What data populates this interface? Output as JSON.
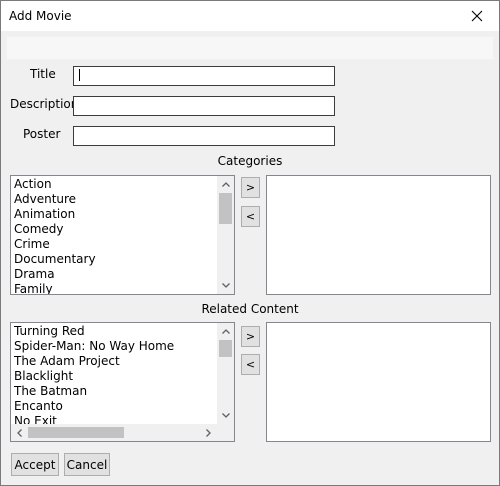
{
  "window": {
    "title": "Add Movie"
  },
  "form": {
    "title_label": "Title",
    "description_label": "Description",
    "poster_label": "Poster",
    "title_value": "",
    "description_value": "",
    "poster_value": ""
  },
  "categories": {
    "heading": "Categories",
    "items": [
      "Action",
      "Adventure",
      "Animation",
      "Comedy",
      "Crime",
      "Documentary",
      "Drama",
      "Family"
    ],
    "add_label": ">",
    "remove_label": "<"
  },
  "related": {
    "heading": "Related Content",
    "items": [
      "Turning Red",
      "Spider-Man: No Way Home",
      "The Adam Project",
      "Blacklight",
      "The Batman",
      "Encanto",
      "No Exit"
    ],
    "add_label": ">",
    "remove_label": "<"
  },
  "buttons": {
    "accept": "Accept",
    "cancel": "Cancel"
  },
  "icons": {
    "close": "close-icon",
    "up": "scroll-up-arrow-icon",
    "down": "scroll-down-arrow-icon",
    "left": "scroll-left-arrow-icon",
    "right": "scroll-right-arrow-icon"
  }
}
